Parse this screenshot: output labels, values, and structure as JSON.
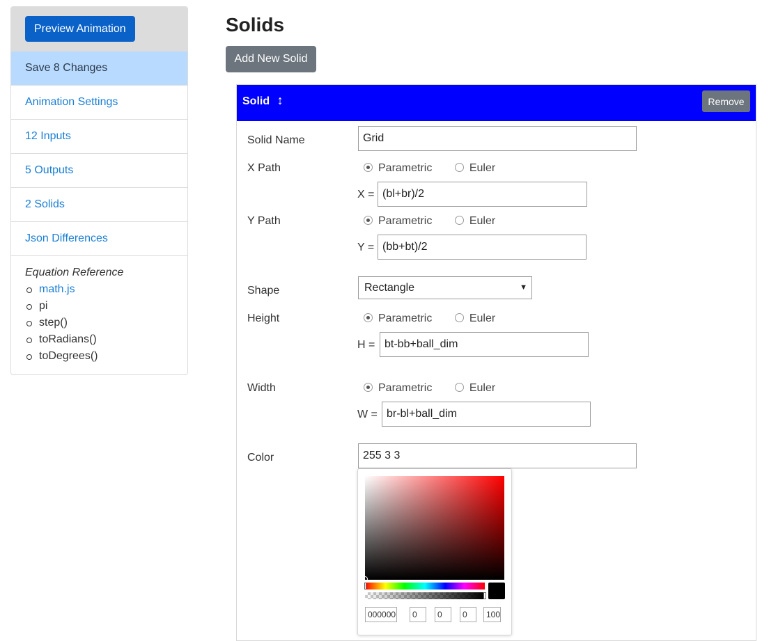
{
  "sidebar": {
    "preview_label": "Preview Animation",
    "items": [
      {
        "label": "Save 8 Changes"
      },
      {
        "label": "Animation Settings"
      },
      {
        "label": "12 Inputs"
      },
      {
        "label": "5 Outputs"
      },
      {
        "label": "2 Solids"
      },
      {
        "label": "Json Differences"
      }
    ],
    "reference": {
      "title": "Equation Reference",
      "items": [
        "math.js",
        "pi",
        "step()",
        "toRadians()",
        "toDegrees()"
      ]
    }
  },
  "main": {
    "title": "Solids",
    "add_label": "Add New Solid",
    "card": {
      "title": "Solid",
      "move_icon": "↕",
      "remove_label": "Remove",
      "header_color": "#0000ff",
      "fields": {
        "name": {
          "label": "Solid Name",
          "value": "Grid"
        },
        "x_path": {
          "label": "X Path",
          "opt1": "Parametric",
          "opt2": "Euler",
          "selected": "Parametric",
          "prefix": "X =",
          "value": "(bl+br)/2"
        },
        "y_path": {
          "label": "Y Path",
          "opt1": "Parametric",
          "opt2": "Euler",
          "selected": "Parametric",
          "prefix": "Y =",
          "value": "(bb+bt)/2"
        },
        "shape": {
          "label": "Shape",
          "value": "Rectangle"
        },
        "height": {
          "label": "Height",
          "opt1": "Parametric",
          "opt2": "Euler",
          "selected": "Parametric",
          "prefix": "H =",
          "value": "bt-bb+ball_dim"
        },
        "width": {
          "label": "Width",
          "opt1": "Parametric",
          "opt2": "Euler",
          "selected": "Parametric",
          "prefix": "W =",
          "value": "br-bl+ball_dim"
        },
        "color": {
          "label": "Color",
          "value": "255 3 3"
        }
      }
    },
    "picker": {
      "hex": "000000",
      "r": "0",
      "g": "0",
      "b": "0",
      "a": "100",
      "hue_color": "#ff0000",
      "swatch_color": "#000000"
    }
  }
}
